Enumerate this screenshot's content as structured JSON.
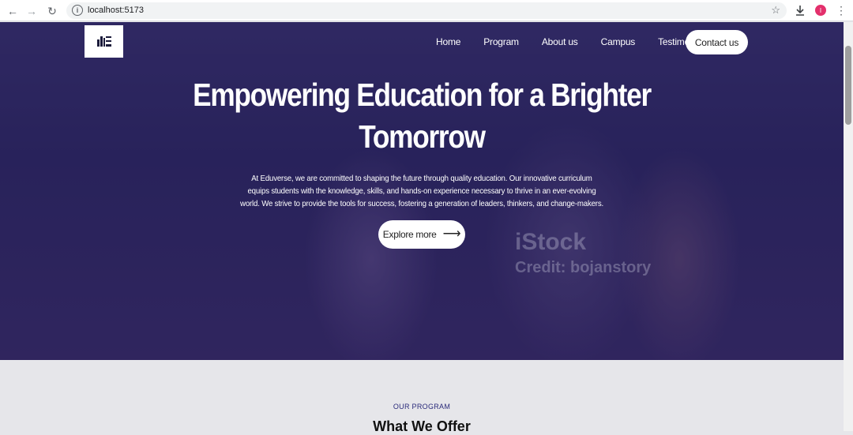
{
  "browser": {
    "url": "localhost:5173",
    "profile_initial": "I"
  },
  "nav": {
    "links": [
      "Home",
      "Program",
      "About us",
      "Campus",
      "Testimonials"
    ],
    "contact_label": "Contact us"
  },
  "hero": {
    "title_line1": "Empowering Education for a Brighter",
    "title_line2": "Tomorrow",
    "paragraph": "At Eduverse, we are committed to shaping the future through quality education. Our innovative curriculum equips students with the knowledge, skills, and hands-on experience necessary to thrive in an ever-evolving world. We strive to provide the tools for success, fostering a generation of leaders, thinkers, and change-makers.",
    "cta_label": "Explore more",
    "watermark_brand": "iStock",
    "watermark_credit": "Credit: bojanstory"
  },
  "program": {
    "subtitle": "OUR PROGRAM",
    "title": "What We Offer"
  },
  "colors": {
    "overlay": "#2f2a5c",
    "accent": "#2a2a7a"
  }
}
